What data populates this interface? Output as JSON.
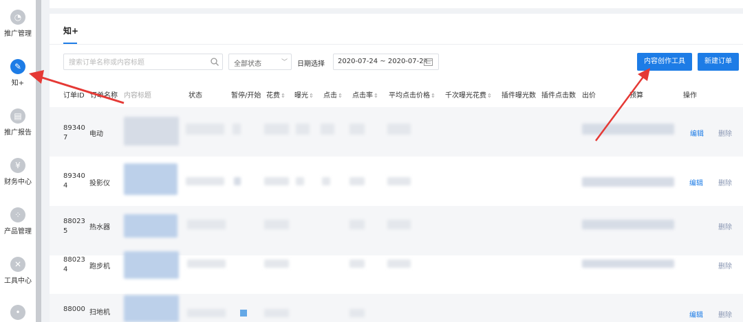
{
  "sidebar": {
    "items": [
      {
        "label": "推广管理",
        "icon": "promo-icon"
      },
      {
        "label": "知+",
        "icon": "pen-icon"
      },
      {
        "label": "推广报告",
        "icon": "report-icon"
      },
      {
        "label": "财务中心",
        "icon": "yen-icon"
      },
      {
        "label": "产品管理",
        "icon": "grid-icon"
      },
      {
        "label": "工具中心",
        "icon": "tools-icon"
      },
      {
        "label": "",
        "icon": "more-icon"
      }
    ]
  },
  "tab": {
    "label": "知+"
  },
  "filters": {
    "search_placeholder": "搜索订单名称或内容标题",
    "status_value": "全部状态",
    "date_label": "日期选择",
    "date_range": "2020-07-24 ~ 2020-07-24"
  },
  "buttons": {
    "content_tool": "内容创作工具",
    "new_order": "新建订单"
  },
  "table": {
    "headers": {
      "order_id": "订单ID",
      "order_name": "订单名称",
      "content_title": "内容标题",
      "status": "状态",
      "pause_start": "暂停/开始",
      "cost": "花费",
      "exposure": "曝光",
      "clicks": "点击",
      "ctr": "点击率",
      "avg_click_price": "平均点击价格",
      "cpm_cost": "千次曝光花费",
      "plugin_exposure": "插件曝光数",
      "plugin_clicks": "插件点击数",
      "bid": "出价",
      "budget": "预算",
      "actions": "操作"
    },
    "rows": [
      {
        "id_line1": "89340",
        "id_line2": "7",
        "name": "电动",
        "edit": "编辑",
        "delete": "删除"
      },
      {
        "id_line1": "89340",
        "id_line2": "4",
        "name": "投影仪",
        "edit": "编辑",
        "delete": "删除"
      },
      {
        "id_line1": "88023",
        "id_line2": "5",
        "name": "热水器",
        "edit": "",
        "delete": "删除"
      },
      {
        "id_line1": "88023",
        "id_line2": "4",
        "name": "跑步机",
        "edit": "",
        "delete": "删除"
      },
      {
        "id_line1": "88000",
        "id_line2": "",
        "name": "扫地机",
        "edit": "编辑",
        "delete": "删除"
      }
    ]
  },
  "colors": {
    "accent": "#1d7ce6",
    "annotation": "#e53935"
  }
}
